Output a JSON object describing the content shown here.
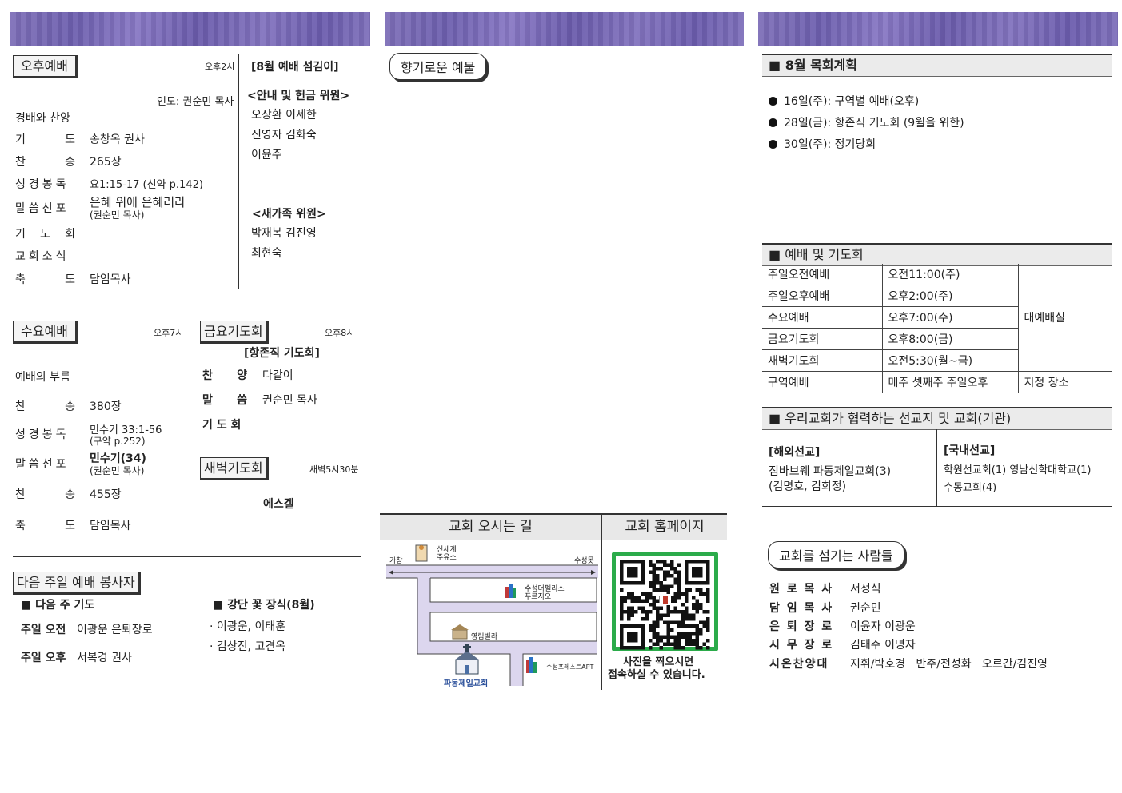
{
  "col1": {
    "afternoon": {
      "title": "오후예배",
      "time": "오후2시",
      "leader": "인도: 권순민 목사",
      "items": [
        {
          "label": "경배와 찬양",
          "value": ""
        },
        {
          "label": "기 도",
          "value": "송창옥 권사"
        },
        {
          "label": "찬 송",
          "value": "265장"
        },
        {
          "label": "성경봉독",
          "value": "요1:15-17 (신약 p.142)"
        },
        {
          "label": "말씀선포",
          "value": "은혜 위에 은혜러라",
          "sub": "(권순민 목사)"
        },
        {
          "label": "기 도 회",
          "value": ""
        },
        {
          "label": "교회소식",
          "value": ""
        },
        {
          "label": "축 도",
          "value": "담임목사"
        }
      ]
    },
    "servers": {
      "title": "[8월 예배 섬김이]",
      "group1": {
        "title": "<안내 및 헌금 위원>",
        "names": [
          "오장환 이세한",
          "진영자 김화숙",
          "이윤주"
        ]
      },
      "group2": {
        "title": "<새가족 위원>",
        "names": [
          "박재복 김진영",
          "최현숙"
        ]
      }
    },
    "wednesday": {
      "title": "수요예배",
      "time": "오후7시",
      "items": [
        {
          "label": "예배의 부름",
          "value": ""
        },
        {
          "label": "찬 송",
          "value": "380장"
        },
        {
          "label": "성경봉독",
          "value": "민수기 33:1-56",
          "sub": "(구약 p.252)"
        },
        {
          "label": "말씀선포",
          "value": "민수기(34)",
          "sub": "(권순민 목사)"
        },
        {
          "label": "찬 송",
          "value": "455장"
        },
        {
          "label": "축 도",
          "value": "담임목사"
        }
      ]
    },
    "friday": {
      "title": "금요기도회",
      "time": "오후8시",
      "sub": "[항존직 기도회]",
      "items": [
        {
          "label": "찬 양",
          "value": "다같이"
        },
        {
          "label": "말 씀",
          "value": "권순민 목사"
        },
        {
          "label": "기 도 회",
          "value": ""
        }
      ]
    },
    "dawn": {
      "title": "새벽기도회",
      "time": "새벽5시30분",
      "value": "에스겔"
    },
    "next": {
      "title": "다음 주일 예배 봉사자",
      "prayer_title": "■ 다음 주 기도",
      "morning_label": "주일 오전",
      "morning_value": "이광운 은퇴장로",
      "afternoon_label": "주일 오후",
      "afternoon_value": "서복경 권사",
      "flower_title": "■ 강단 꽃 장식(8월)",
      "flowers": [
        "· 이광운, 이태훈",
        "· 김상진, 고견옥"
      ]
    }
  },
  "col2": {
    "offering_title": "향기로운 예물",
    "directions_title": "교회 오시는 길",
    "homepage_title": "교회 홈페이지",
    "map": {
      "left_label": "가창",
      "right_label": "수성못",
      "gas_station": "신세계\n주유소",
      "apt1": "수성더펠리스\n푸르지오",
      "villa": "영림빌라",
      "church": "파동제일교회",
      "apt2": "수성포레스트APT"
    },
    "qr_caption_1": "사진을 찍으시면",
    "qr_caption_2": "접속하실 수 있습니다."
  },
  "col3": {
    "plan": {
      "title": "■ 8월 목회계획",
      "items": [
        "16일(주): 구역별 예배(오후)",
        "28일(금): 항존직 기도회 (9월을 위한)",
        "30일(주): 정기당회"
      ]
    },
    "worship": {
      "title": "■ 예배 및 기도회",
      "rows": [
        {
          "name": "주일오전예배",
          "time": "오전11:00(주)"
        },
        {
          "name": "주일오후예배",
          "time": "오후2:00(주)"
        },
        {
          "name": "수요예배",
          "time": "오후7:00(수)"
        },
        {
          "name": "금요기도회",
          "time": "오후8:00(금)"
        },
        {
          "name": "새벽기도회",
          "time": "오전5:30(월~금)"
        },
        {
          "name": "구역예배",
          "time": "매주 셋째주 주일오후"
        }
      ],
      "place_main": "대예배실",
      "place_district": "지정 장소"
    },
    "mission": {
      "title": "■ 우리교회가 협력하는 선교지 및 교회(기관)",
      "overseas_title": "[해외선교]",
      "overseas": [
        "짐바브웨 파동제일교회(3)",
        "(김명호, 김희정)"
      ],
      "domestic_title": "[국내선교]",
      "domestic": [
        "학원선교회(1) 영남신학대학교(1)",
        "수동교회(4)"
      ]
    },
    "people": {
      "title": "교회를 섬기는 사람들",
      "rows": [
        {
          "label": "원 로 목 사",
          "value": "서정식"
        },
        {
          "label": "담 임 목 사",
          "value": "권순민"
        },
        {
          "label": "은 퇴 장 로",
          "value": "이윤자 이광운"
        },
        {
          "label": "시 무 장 로",
          "value": "김태주 이명자"
        },
        {
          "label": "시온찬양대",
          "value": "지휘/박호경   반주/전성화   오르간/김진영"
        }
      ]
    }
  }
}
